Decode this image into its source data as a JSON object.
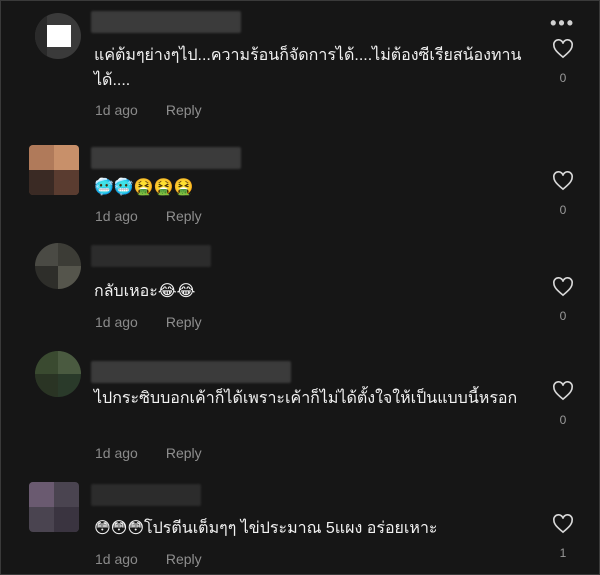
{
  "header": {
    "more_icon": "more-dots-icon",
    "more_label": "•••"
  },
  "comments": [
    {
      "text": "แค่ต้มๆย่างๆไป...ความร้อนก็จัดการได้....ไม่ต้องซีเรียสน้องทานได้....",
      "time": "1d ago",
      "reply": "Reply",
      "likes": "0"
    },
    {
      "text": "🥶🥶🤮🤮🤮",
      "time": "1d ago",
      "reply": "Reply",
      "likes": "0"
    },
    {
      "text": "กลับเหอะ😂😂",
      "time": "1d ago",
      "reply": "Reply",
      "likes": "0"
    },
    {
      "text": "ไปกระซิบบอกเค้าก็ได้เพราะเค้าก็ไม่ได้ตั้งใจให้เป็นแบบนี้หรอก",
      "time": "1d ago",
      "reply": "Reply",
      "likes": "0"
    },
    {
      "text": "😳😳😳โปรตีนเต็มๆๆ ไข่ประมาณ 5แผง อร่อยเหาะ",
      "time": "1d ago",
      "reply": "Reply",
      "likes": "1"
    }
  ]
}
